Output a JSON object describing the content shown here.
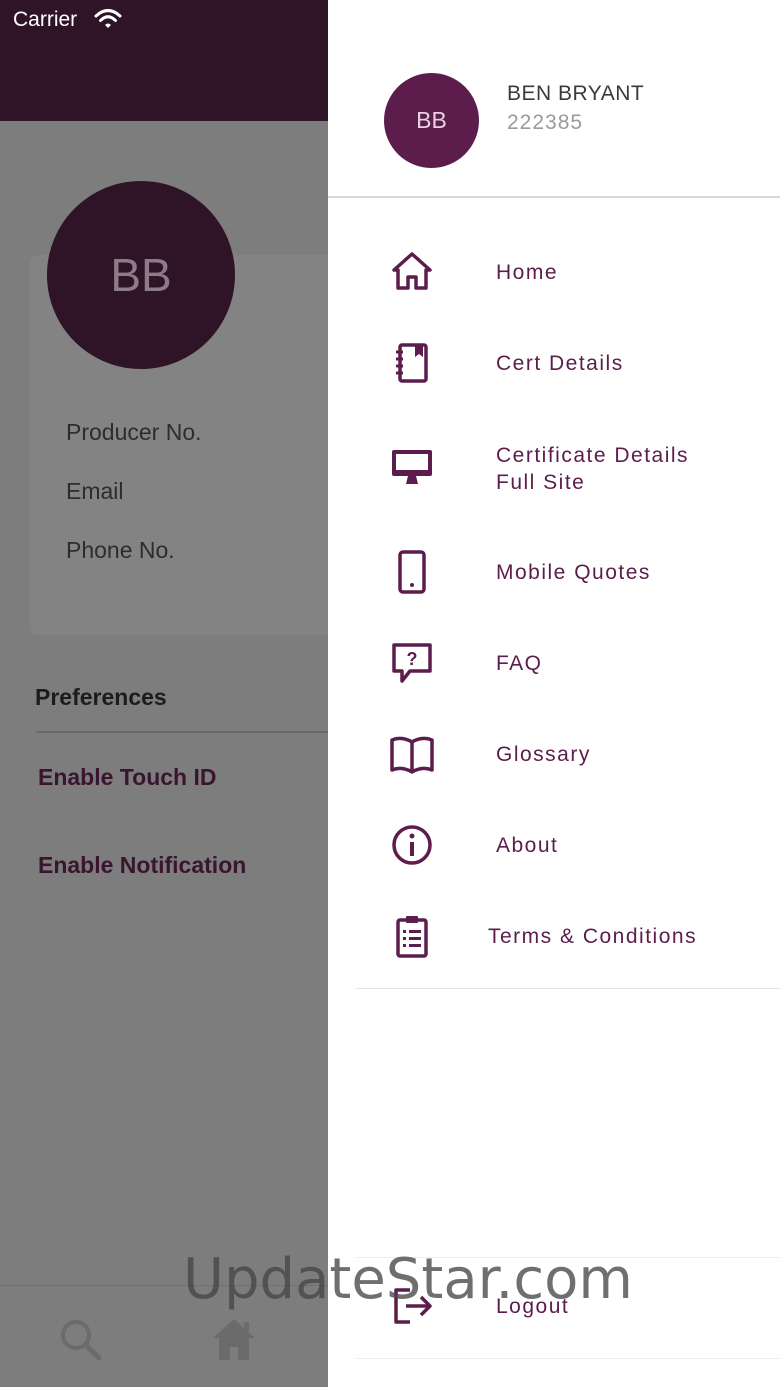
{
  "status_bar": {
    "carrier": "Carrier"
  },
  "background": {
    "avatar_initials": "BB",
    "fields": [
      "Producer No.",
      "Email",
      "Phone No."
    ],
    "preferences_heading": "Preferences",
    "toggles": [
      "Enable Touch ID",
      "Enable Notification"
    ],
    "tabs": [
      {
        "icon": "search-icon"
      },
      {
        "icon": "home-icon"
      }
    ]
  },
  "drawer": {
    "avatar_initials": "BB",
    "user_name": "BEN BRYANT",
    "user_id": "222385",
    "menu": [
      {
        "label": "Home",
        "icon": "home-icon"
      },
      {
        "label": "Cert Details",
        "icon": "notebook-icon"
      },
      {
        "label": "Certificate Details\nFull Site",
        "icon": "desktop-icon"
      },
      {
        "label": "Mobile Quotes",
        "icon": "mobile-phone-icon"
      },
      {
        "label": "FAQ",
        "icon": "question-bubble-icon"
      },
      {
        "label": "Glossary",
        "icon": "book-icon"
      },
      {
        "label": "About",
        "icon": "info-icon"
      },
      {
        "label": "Terms & Conditions",
        "icon": "clipboard-list-icon"
      }
    ],
    "logout_label": "Logout"
  },
  "watermark": "UpdateStar.com",
  "colors": {
    "brand": "#5c1d4c",
    "header_dark": "#2f1428",
    "overlay_gray": "#7d7d7d"
  }
}
